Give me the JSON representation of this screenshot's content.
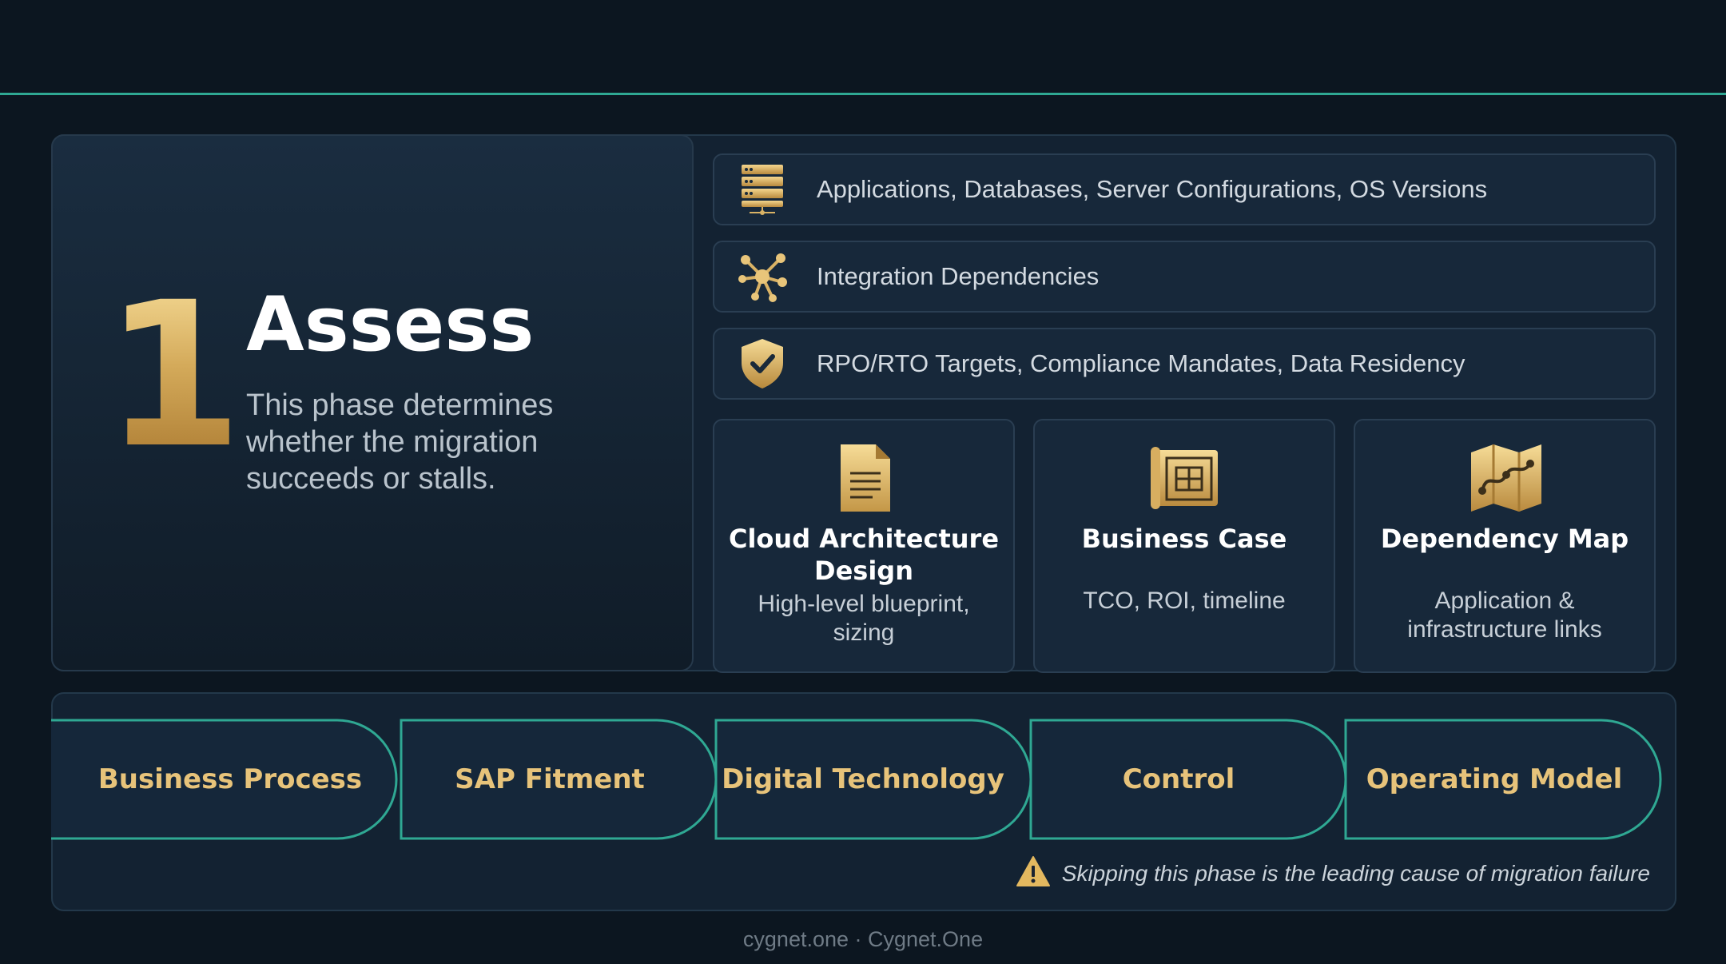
{
  "phase": {
    "number": "1",
    "title": "Assess",
    "description": "This phase determines whether the migration succeeds or stalls."
  },
  "inputs": [
    {
      "icon": "server-stack-icon",
      "label": "Applications, Databases, Server Configurations, OS Versions"
    },
    {
      "icon": "network-nodes-icon",
      "label": "Integration Dependencies"
    },
    {
      "icon": "shield-check-icon",
      "label": "RPO/RTO Targets, Compliance Mandates, Data Residency"
    }
  ],
  "outputs": [
    {
      "icon": "document-icon",
      "title": "Cloud Architecture Design",
      "subtitle": "High-level blueprint, sizing"
    },
    {
      "icon": "blueprint-scroll-icon",
      "title": "Business Case",
      "subtitle": "TCO, ROI, timeline"
    },
    {
      "icon": "folded-map-icon",
      "title": "Dependency Map",
      "subtitle": "Application & infrastructure links"
    }
  ],
  "pillars": [
    "Business Process",
    "SAP Fitment",
    "Digital Technology",
    "Control",
    "Operating Model"
  ],
  "warning": {
    "icon": "warning-triangle-icon",
    "text": "Skipping this phase is the leading cause of migration failure"
  },
  "footer": "cygnet.one · Cygnet.One",
  "colors": {
    "background": "#0c1620",
    "accent_teal": "#2fa893",
    "gold": "#e7c37a",
    "panel": "#132232"
  }
}
